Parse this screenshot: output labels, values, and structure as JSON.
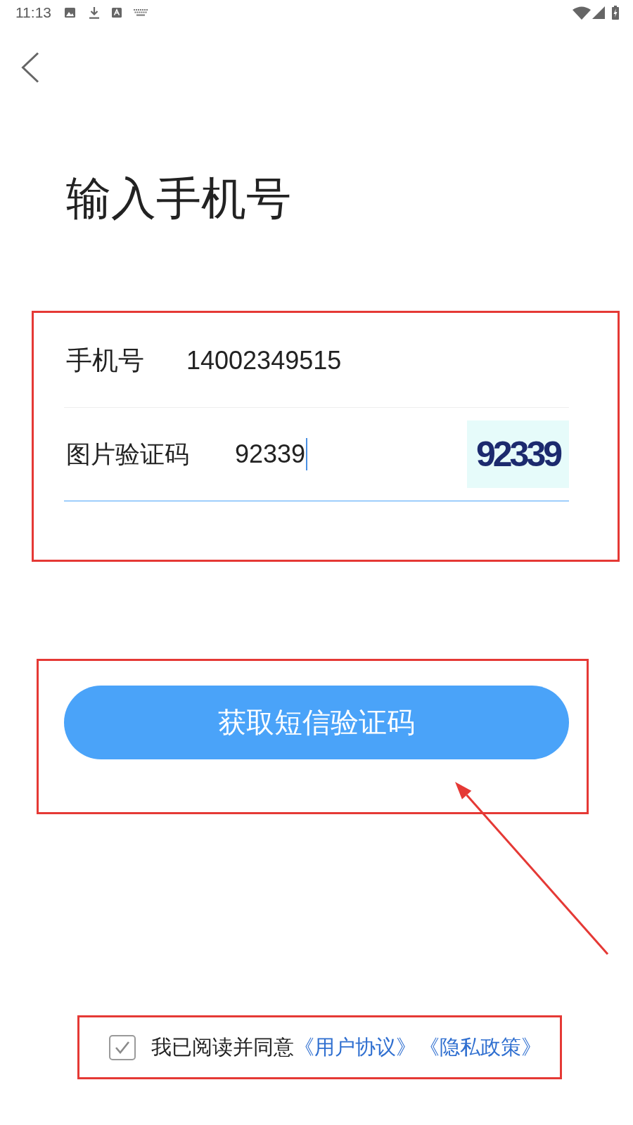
{
  "status_bar": {
    "time": "11:13"
  },
  "header": {
    "title": "输入手机号"
  },
  "form": {
    "highlighted": true,
    "fields": [
      {
        "kind": "text",
        "label": "手机号",
        "value": "14002349515",
        "focused": false
      },
      {
        "kind": "captcha",
        "label": "图片验证码",
        "value": "92339",
        "focused": true,
        "captcha_text": "92339"
      }
    ]
  },
  "submit": {
    "label": "获取短信验证码",
    "highlighted": true
  },
  "pointer_arrow": true,
  "agreement": {
    "highlighted": true,
    "checked": true,
    "text": "我已阅读并同意",
    "links": [
      "《用户协议》",
      "《隐私政策》"
    ]
  }
}
